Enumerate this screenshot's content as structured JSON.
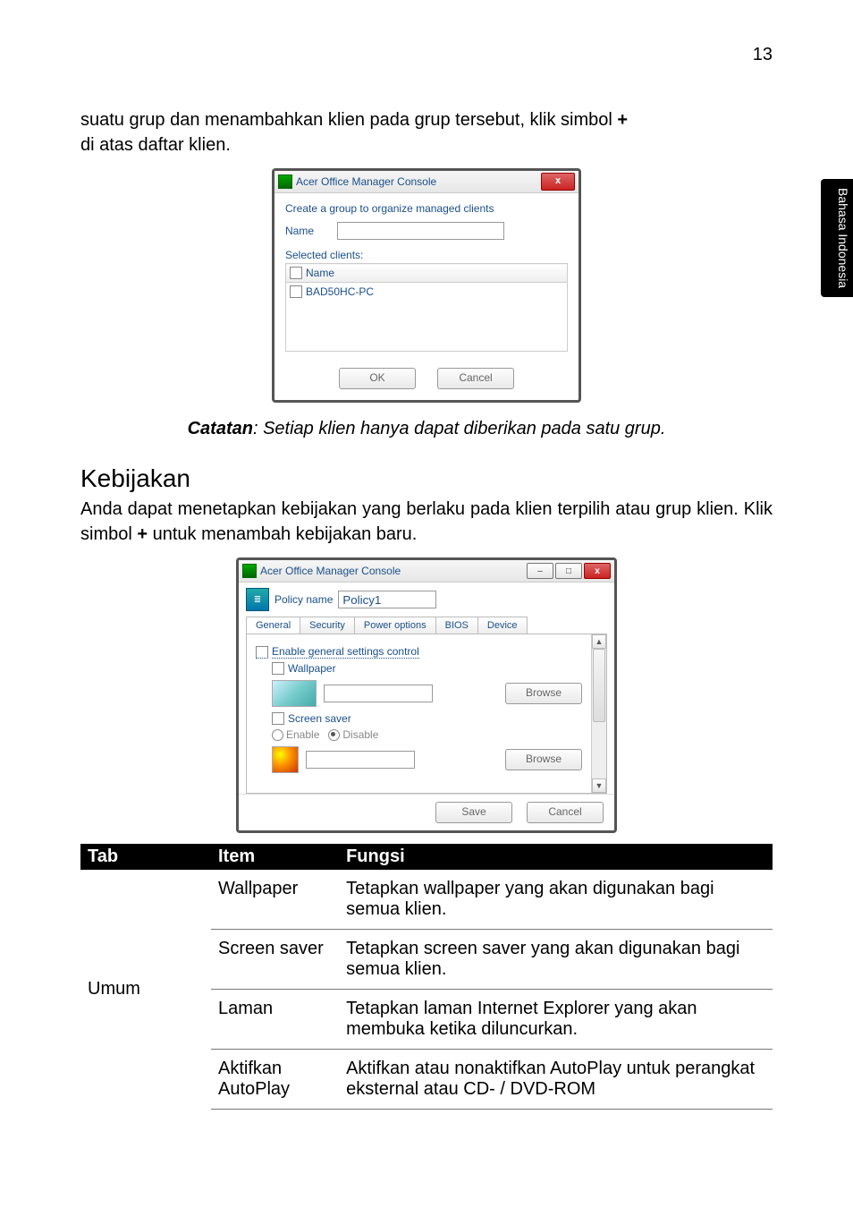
{
  "page_number": "13",
  "side_tab": "Bahasa Indonesia",
  "intro_line1": "suatu grup dan menambahkan klien pada grup tersebut, klik simbol ",
  "intro_plus": "+",
  "intro_line2": "di atas daftar klien.",
  "note_prefix": "Catatan",
  "note_rest": ": Setiap klien hanya dapat diberikan pada satu grup.",
  "kebijakan_heading": "Kebijakan",
  "kebijakan_body_a": "Anda dapat menetapkan kebijakan yang berlaku pada klien terpilih atau grup klien. Klik simbol ",
  "kebijakan_plus": "+",
  "kebijakan_body_b": " untuk menambah kebijakan baru.",
  "dlg1": {
    "title": "Acer Office Manager Console",
    "close_x": "x",
    "heading": "Create a group to organize managed clients",
    "name_label": "Name",
    "name_value": "",
    "selected_label": "Selected clients:",
    "col_name": "Name",
    "client1": "BAD50HC-PC",
    "ok": "OK",
    "cancel": "Cancel"
  },
  "dlg2": {
    "title": "Acer Office Manager Console",
    "min_glyph": "–",
    "max_glyph": "□",
    "close_x": "x",
    "policy_name_label": "Policy name",
    "policy_name_value": "Policy1",
    "tabs": {
      "general": "General",
      "security": "Security",
      "power": "Power options",
      "bios": "BIOS",
      "device": "Device"
    },
    "enable_general": "Enable general settings control",
    "wallpaper": "Wallpaper",
    "browse": "Browse",
    "screen_saver": "Screen saver",
    "enable": "Enable",
    "disable": "Disable",
    "save": "Save",
    "cancel": "Cancel",
    "up_glyph": "▲",
    "down_glyph": "▼"
  },
  "info_table": {
    "head_tab": "Tab",
    "head_item": "Item",
    "head_func": "Fungsi",
    "tab_name": "Umum",
    "rows": [
      {
        "item": "Wallpaper",
        "func": "Tetapkan wallpaper yang akan digunakan bagi semua klien."
      },
      {
        "item": "Screen saver",
        "func": "Tetapkan screen saver yang akan digunakan bagi semua klien."
      },
      {
        "item": "Laman",
        "func": "Tetapkan laman Internet Explorer yang akan membuka ketika diluncurkan."
      },
      {
        "item": "Aktifkan AutoPlay",
        "func": "Aktifkan atau nonaktifkan AutoPlay untuk perangkat eksternal atau CD- / DVD-ROM"
      }
    ]
  }
}
